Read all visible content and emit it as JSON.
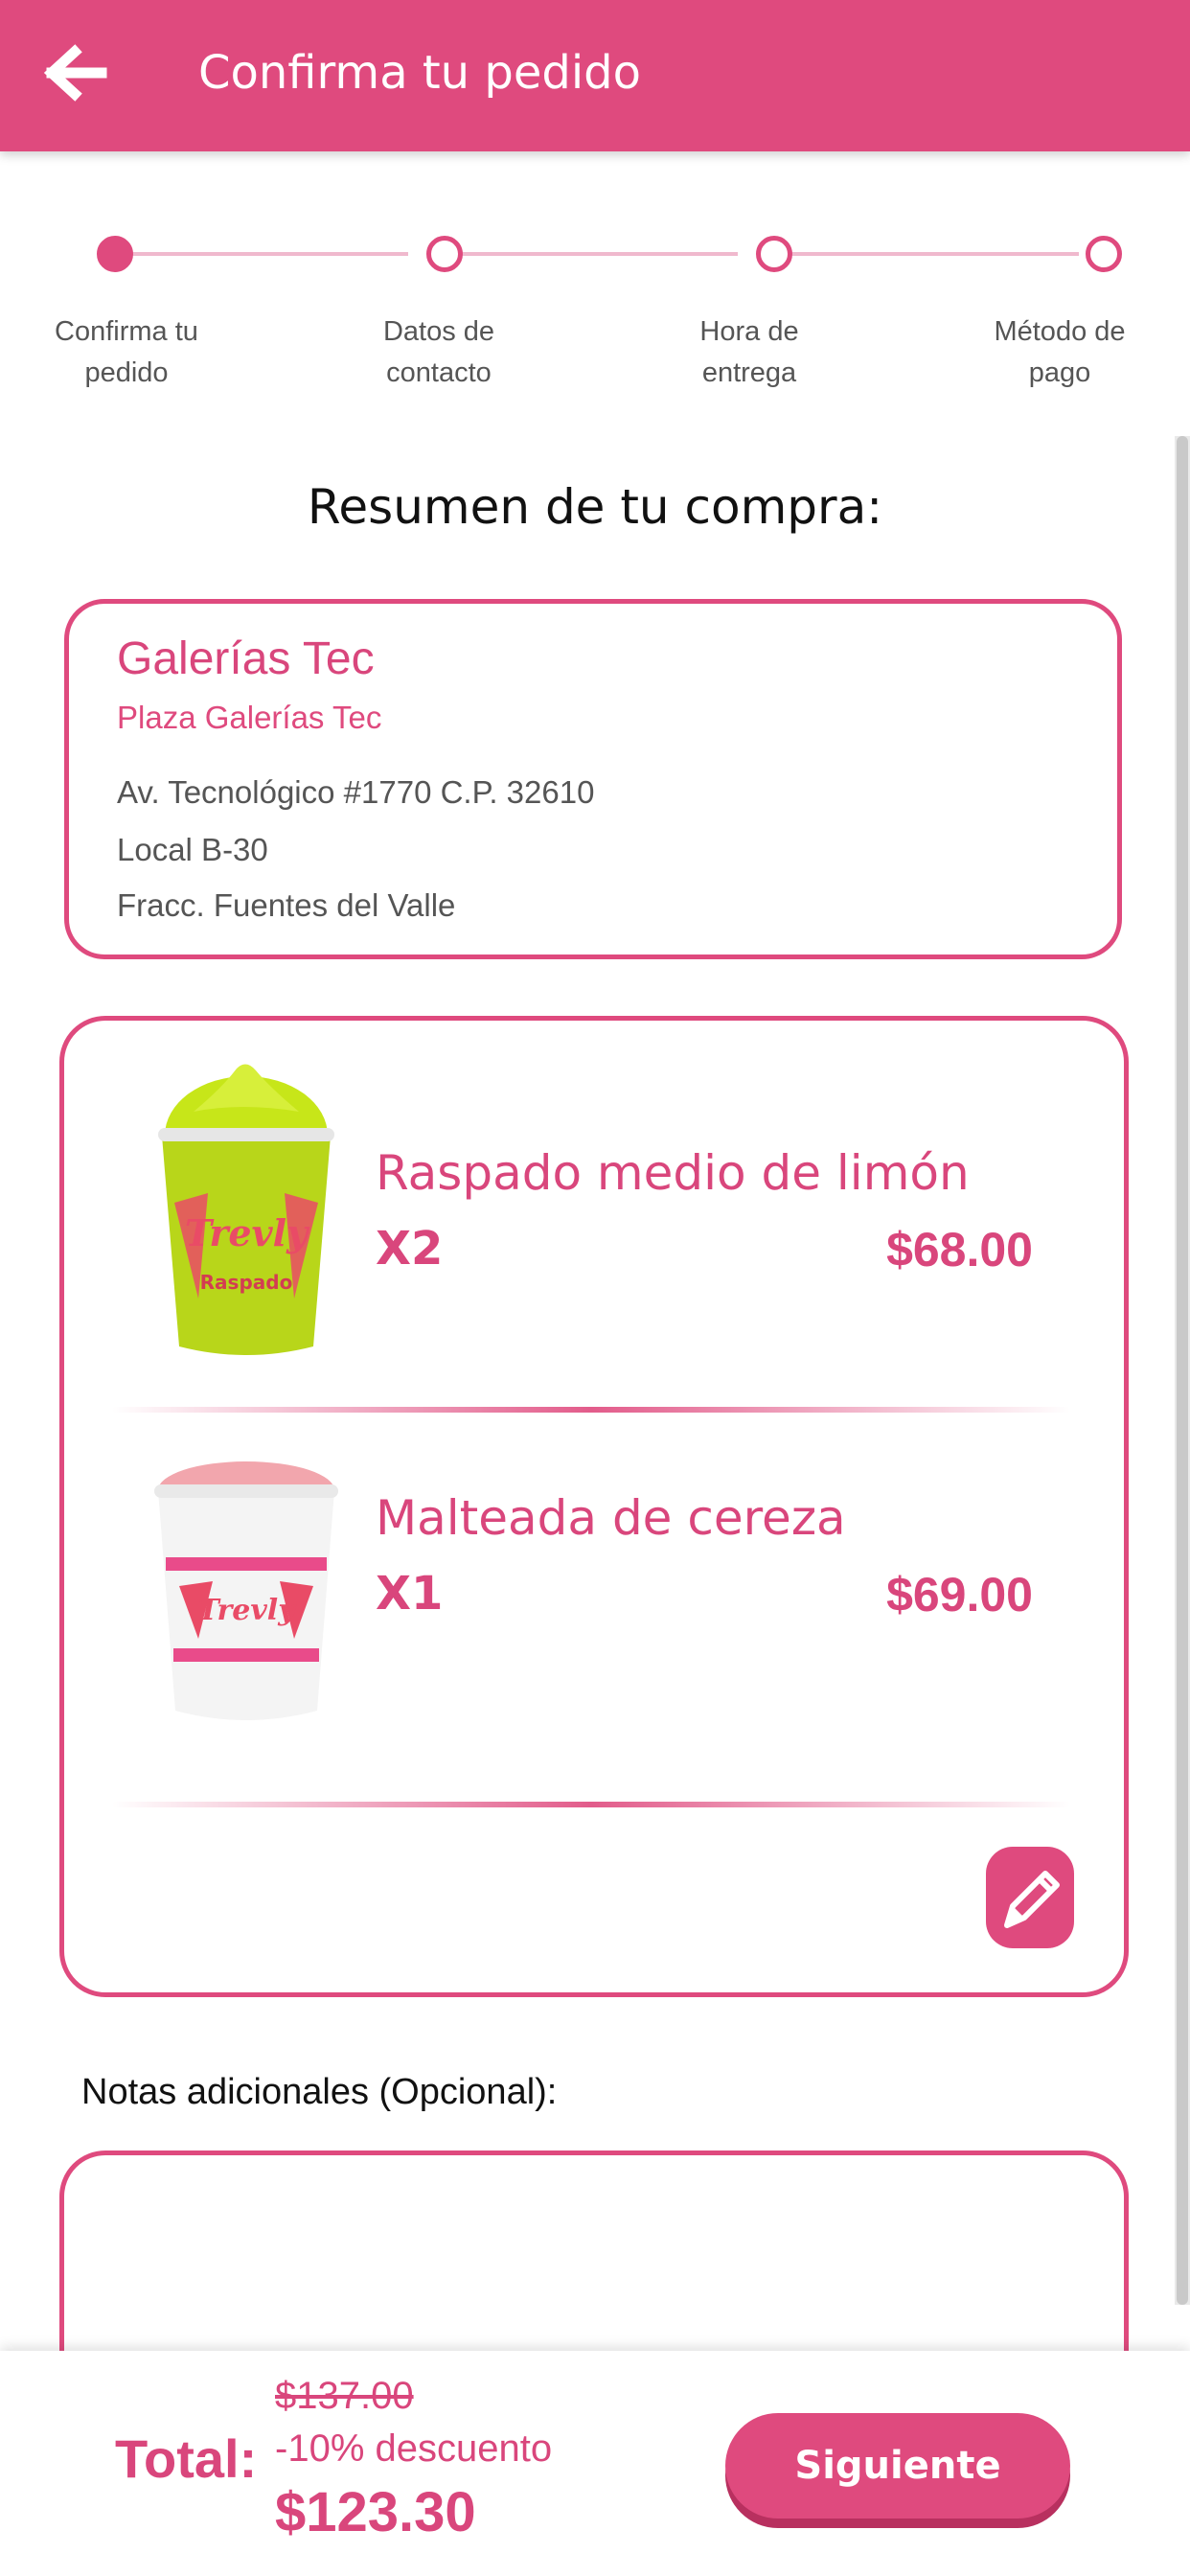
{
  "header": {
    "title": "Confirma tu pedido",
    "back_icon": "arrow-left-icon"
  },
  "colors": {
    "primary": "#df4a7e",
    "primary_dark": "#b8305f",
    "step_line": "#f0b9cd"
  },
  "stepper": {
    "active_index": 0,
    "steps": [
      {
        "line1": "Confirma tu",
        "line2": "pedido"
      },
      {
        "line1": "Datos de",
        "line2": "contacto"
      },
      {
        "line1": "Hora de",
        "line2": "entrega"
      },
      {
        "line1": "Método de",
        "line2": "pago"
      }
    ]
  },
  "summary_title": "Resumen de tu compra:",
  "store": {
    "name": "Galerías Tec",
    "plaza": "Plaza Galerías Tec",
    "address_line1": "Av. Tecnológico #1770 C.P. 32610",
    "address_line2": "Local B-30",
    "address_line3": "Fracc. Fuentes del Valle"
  },
  "order": {
    "items": [
      {
        "name": "Raspado medio de limón",
        "qty": "X2",
        "price": "$68.00",
        "image": "lime-raspado-cup",
        "cup_brand": "Trevly",
        "cup_label": "Raspado"
      },
      {
        "name": "Malteada de cereza",
        "qty": "X1",
        "price": "$69.00",
        "image": "cherry-malteada-cup",
        "cup_brand": "Trevly"
      }
    ],
    "edit_icon": "pencil-icon"
  },
  "notes": {
    "label": "Notas adicionales (Opcional):",
    "value": "",
    "placeholder": ""
  },
  "footer": {
    "total_label": "Total:",
    "original_price": "$137.00",
    "discount_text": "-10% descuento",
    "final_price": "$123.30",
    "next_label": "Siguiente"
  }
}
